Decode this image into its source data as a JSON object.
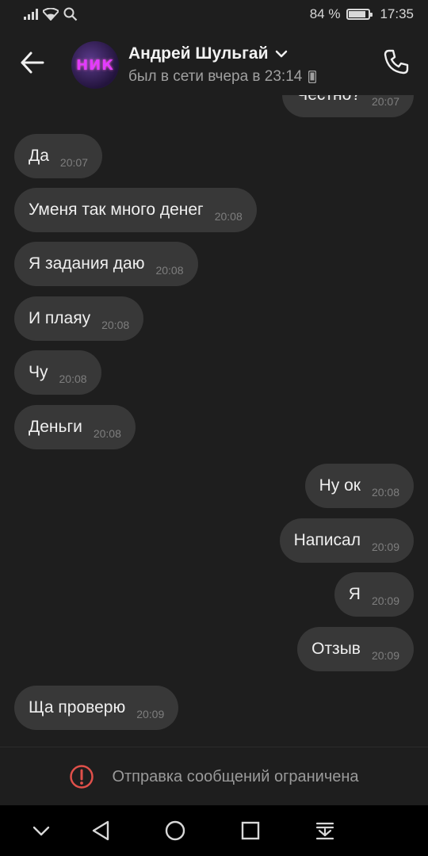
{
  "status_bar": {
    "battery": "84 %",
    "battery_level": 0.84,
    "time": "17:35"
  },
  "header": {
    "contact_name": "Андрей Шульгай",
    "contact_status": "был в сети вчера в 23:14",
    "avatar_text": "НИК"
  },
  "messages": [
    {
      "side": "out",
      "text": "Честно?",
      "time": "20:07"
    },
    {
      "side": "in",
      "text": "Да",
      "time": "20:07"
    },
    {
      "side": "in",
      "text": "Уменя так много денег",
      "time": "20:08"
    },
    {
      "side": "in",
      "text": "Я задания даю",
      "time": "20:08"
    },
    {
      "side": "in",
      "text": "И плаяу",
      "time": "20:08"
    },
    {
      "side": "in",
      "text": "Чу",
      "time": "20:08"
    },
    {
      "side": "in",
      "text": "Деньги",
      "time": "20:08"
    },
    {
      "side": "out",
      "text": "Ну ок",
      "time": "20:08"
    },
    {
      "side": "out",
      "text": "Написал",
      "time": "20:09"
    },
    {
      "side": "out",
      "text": "Я",
      "time": "20:09"
    },
    {
      "side": "out",
      "text": "Отзыв",
      "time": "20:09"
    },
    {
      "side": "in",
      "text": "Ща проверю",
      "time": "20:09"
    }
  ],
  "restriction": {
    "text": "Отправка сообщений ограничена"
  },
  "colors": {
    "background": "#1e1e1e",
    "bubble": "#383838",
    "warning": "#e0504a"
  },
  "icons": [
    "signal-icon",
    "wifi-icon",
    "search-icon",
    "battery-icon",
    "back-arrow-icon",
    "chevron-down-icon",
    "mobile-icon",
    "phone-icon",
    "alert-icon",
    "nav-down-icon",
    "nav-back-icon",
    "nav-home-icon",
    "nav-recent-icon",
    "nav-notifications-icon"
  ]
}
